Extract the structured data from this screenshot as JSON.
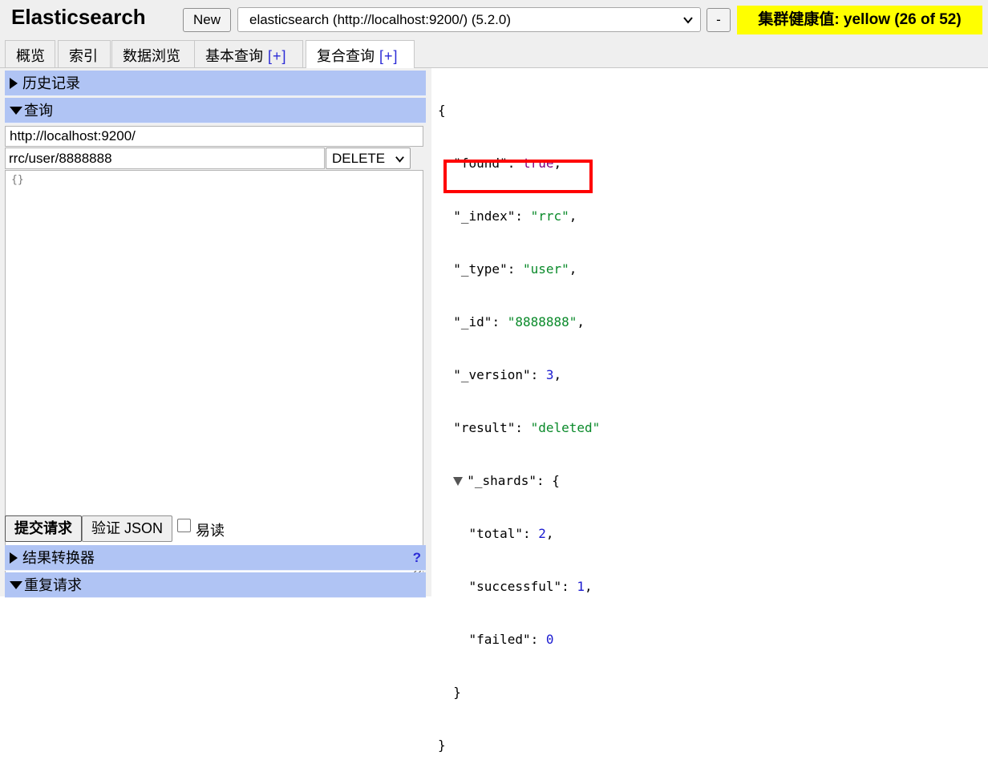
{
  "app_title": "Elasticsearch",
  "header": {
    "new_label": "New",
    "cluster_url": "elasticsearch (http://localhost:9200/) (5.2.0)",
    "minus_label": "-",
    "health": "集群健康值: yellow (26 of 52)",
    "health_color": "#ffff00"
  },
  "tabs": [
    {
      "label": "概览"
    },
    {
      "label": "索引"
    },
    {
      "label": "数据浏览"
    },
    {
      "label": "基本查询",
      "plus": "[+]"
    },
    {
      "label": "复合查询",
      "plus": "[+]"
    }
  ],
  "left": {
    "history_label": "历史记录",
    "query_label": "查询",
    "url_value": "http://localhost:9200/",
    "path_value": "rrc/user/8888888",
    "method_value": "DELETE",
    "body_value": "{}",
    "submit_label": "提交请求",
    "validate_label": "验证 JSON",
    "pretty_label": "易读",
    "transformer_label": "结果转换器",
    "help_label": "?",
    "repeat_label": "重复请求"
  },
  "result": {
    "open_brace": "{",
    "found_key": "\"found\"",
    "found_value": "true",
    "index_key": "\"_index\"",
    "index_value": "\"rrc\"",
    "type_key": "\"_type\"",
    "type_value": "\"user\"",
    "id_key": "\"_id\"",
    "id_value": "\"8888888\"",
    "version_key": "\"_version\"",
    "version_value": "3",
    "result_key": "\"result\"",
    "result_value": "\"deleted\"",
    "shards_key": "\"_shards\"",
    "total_key": "\"total\"",
    "total_value": "2",
    "successful_key": "\"successful\"",
    "successful_value": "1",
    "failed_key": "\"failed\"",
    "failed_value": "0",
    "inner_close": "}",
    "close_brace": "}"
  },
  "accent_colors": {
    "section_bar": "#b0c4f4",
    "highlight_box": "#ff0000",
    "json_string": "#0a8a2a",
    "json_number": "#1a1ad0",
    "json_boolean": "#800080"
  }
}
